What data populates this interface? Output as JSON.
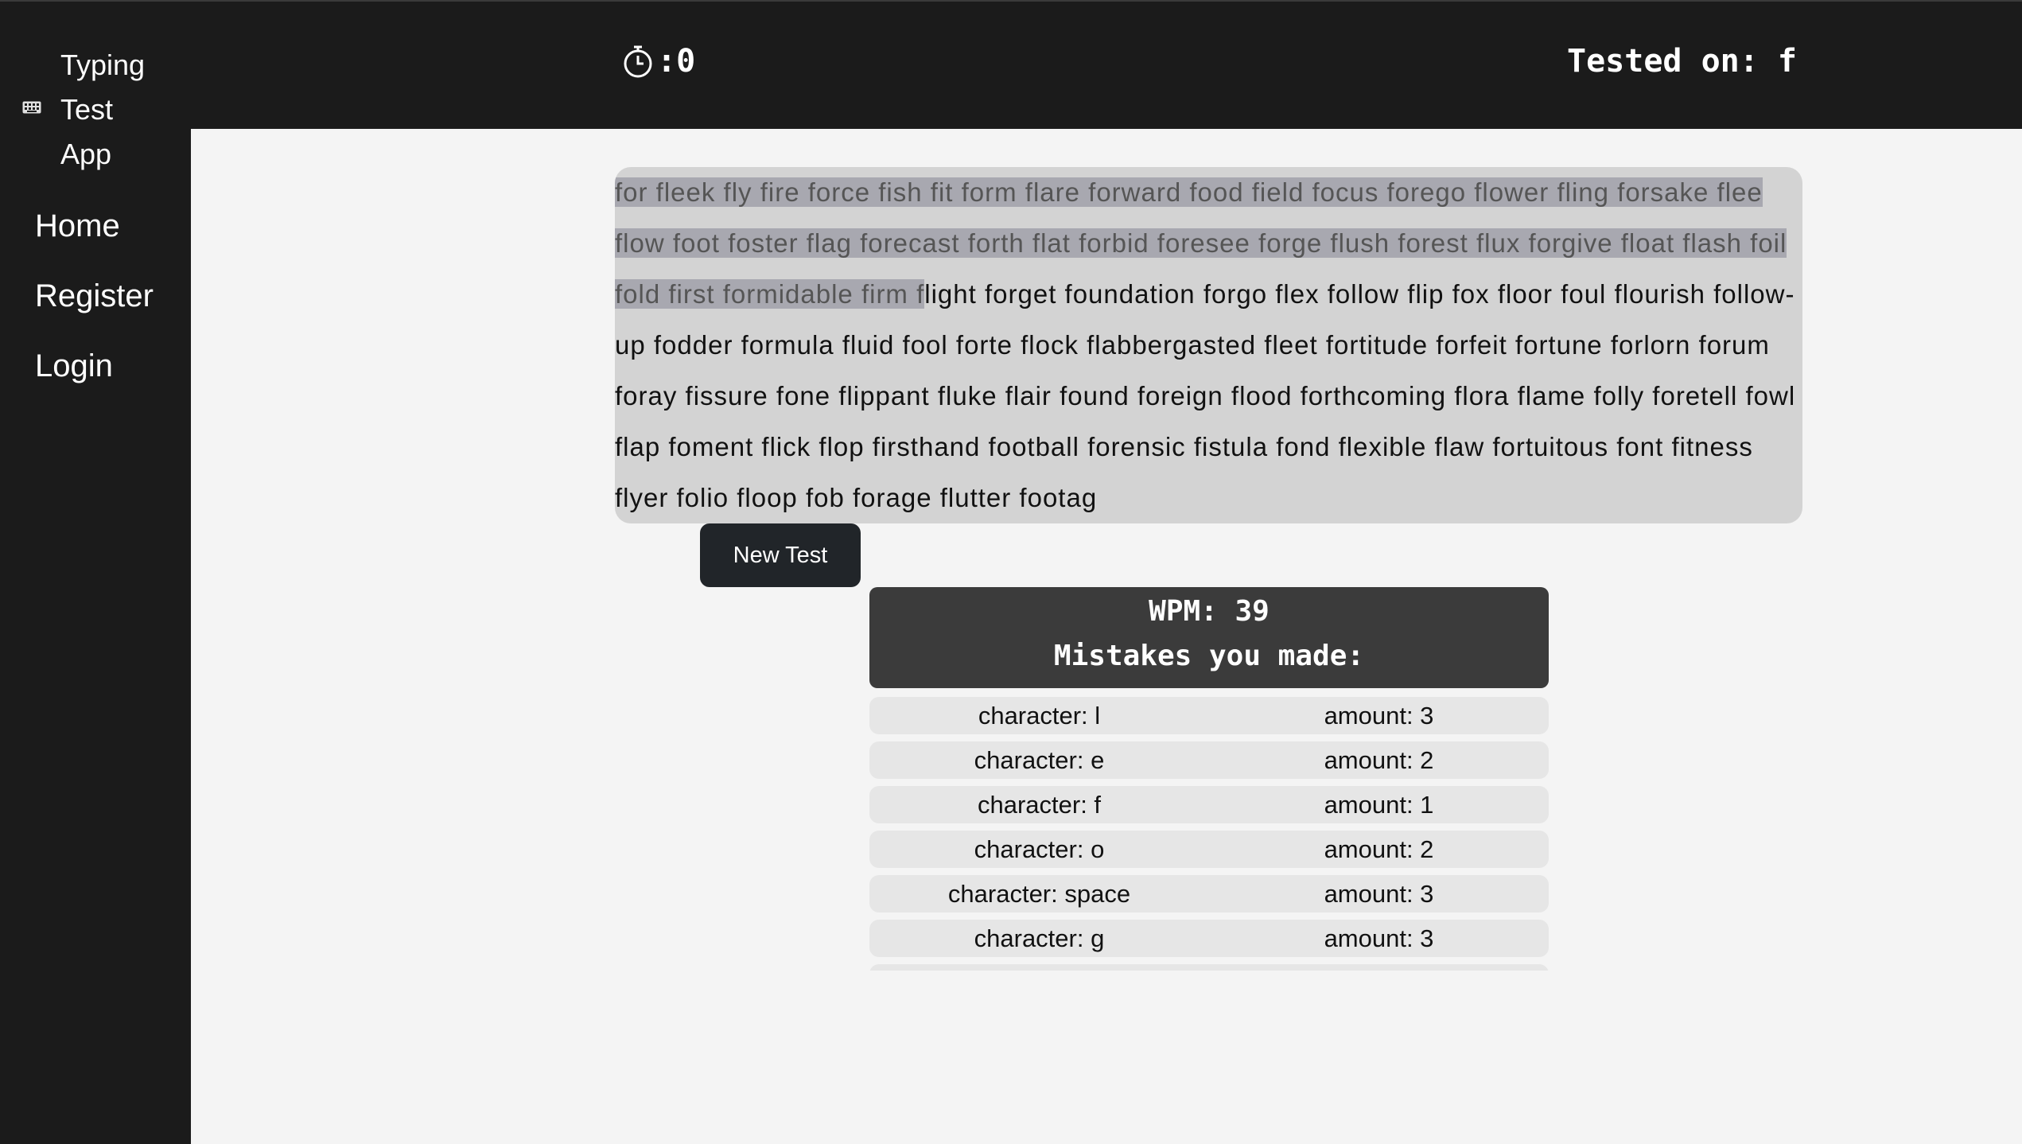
{
  "app": {
    "title_line1": "Typing",
    "title_line2": "Test",
    "title_line3": "App",
    "icon": "keyboard-icon"
  },
  "nav": {
    "home": "Home",
    "register": "Register",
    "login": "Login"
  },
  "header": {
    "timer_icon": "stopwatch-icon",
    "timer_value": ":0",
    "tested_on": "Tested on: f"
  },
  "test_text": {
    "typed": "for fleek fly fire force fish fit form flare forward food field focus forego flower fling forsake flee flow foot foster flag forecast forth flat forbid foresee forge flush forest flux forgive float flash foil fold first formidable firm f",
    "remaining": "light forget foundation forgo flex follow flip fox floor foul flourish follow-up fodder formula fluid fool forte flock flabbergasted fleet fortitude forfeit fortune forlorn forum foray fissure fone flippant fluke flair found foreign flood forthcoming flora flame folly foretell fowl flap foment flick flop firsthand football forensic fistula fond flexible flaw fortuitous font fitness flyer folio floop fob forage flutter footag"
  },
  "buttons": {
    "new_test": "New Test"
  },
  "results": {
    "wpm": "WPM: 39",
    "mistakes_title": "Mistakes you made:"
  },
  "mistakes": [
    {
      "character": "character: l",
      "amount": "amount: 3"
    },
    {
      "character": "character: e",
      "amount": "amount: 2"
    },
    {
      "character": "character: f",
      "amount": "amount: 1"
    },
    {
      "character": "character: o",
      "amount": "amount: 2"
    },
    {
      "character": "character: space",
      "amount": "amount: 3"
    },
    {
      "character": "character: g",
      "amount": "amount: 3"
    }
  ],
  "colors": {
    "sidebar": "#1b1b1b",
    "page_bg": "#f4f4f4",
    "text_box": "#d3d3d3",
    "typed_highlight": "#a8a8b0",
    "results_bg": "#3b3b3b",
    "mistake_row": "#e6e6e6",
    "button": "#212529"
  }
}
